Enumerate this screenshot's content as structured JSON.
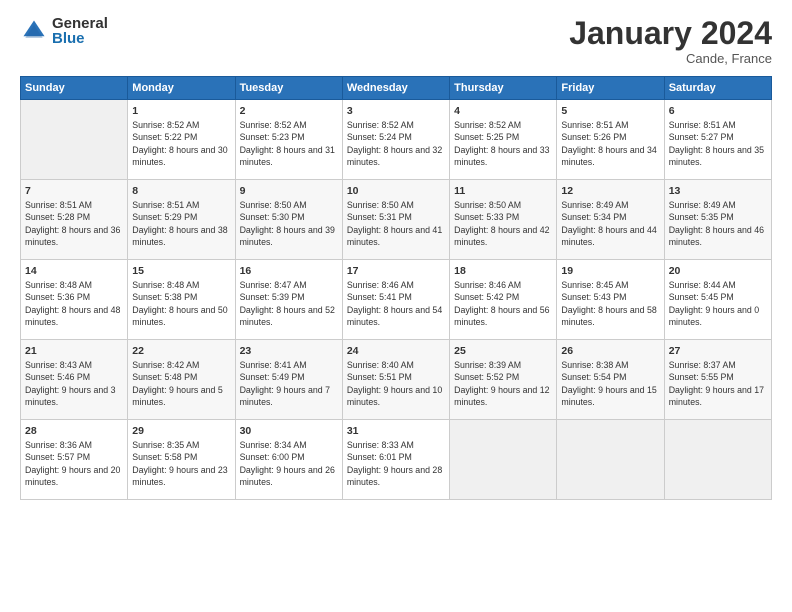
{
  "header": {
    "logo_general": "General",
    "logo_blue": "Blue",
    "title": "January 2024",
    "subtitle": "Cande, France"
  },
  "weekdays": [
    "Sunday",
    "Monday",
    "Tuesday",
    "Wednesday",
    "Thursday",
    "Friday",
    "Saturday"
  ],
  "weeks": [
    [
      {
        "day": "",
        "sunrise": "",
        "sunset": "",
        "daylight": ""
      },
      {
        "day": "1",
        "sunrise": "Sunrise: 8:52 AM",
        "sunset": "Sunset: 5:22 PM",
        "daylight": "Daylight: 8 hours and 30 minutes."
      },
      {
        "day": "2",
        "sunrise": "Sunrise: 8:52 AM",
        "sunset": "Sunset: 5:23 PM",
        "daylight": "Daylight: 8 hours and 31 minutes."
      },
      {
        "day": "3",
        "sunrise": "Sunrise: 8:52 AM",
        "sunset": "Sunset: 5:24 PM",
        "daylight": "Daylight: 8 hours and 32 minutes."
      },
      {
        "day": "4",
        "sunrise": "Sunrise: 8:52 AM",
        "sunset": "Sunset: 5:25 PM",
        "daylight": "Daylight: 8 hours and 33 minutes."
      },
      {
        "day": "5",
        "sunrise": "Sunrise: 8:51 AM",
        "sunset": "Sunset: 5:26 PM",
        "daylight": "Daylight: 8 hours and 34 minutes."
      },
      {
        "day": "6",
        "sunrise": "Sunrise: 8:51 AM",
        "sunset": "Sunset: 5:27 PM",
        "daylight": "Daylight: 8 hours and 35 minutes."
      }
    ],
    [
      {
        "day": "7",
        "sunrise": "Sunrise: 8:51 AM",
        "sunset": "Sunset: 5:28 PM",
        "daylight": "Daylight: 8 hours and 36 minutes."
      },
      {
        "day": "8",
        "sunrise": "Sunrise: 8:51 AM",
        "sunset": "Sunset: 5:29 PM",
        "daylight": "Daylight: 8 hours and 38 minutes."
      },
      {
        "day": "9",
        "sunrise": "Sunrise: 8:50 AM",
        "sunset": "Sunset: 5:30 PM",
        "daylight": "Daylight: 8 hours and 39 minutes."
      },
      {
        "day": "10",
        "sunrise": "Sunrise: 8:50 AM",
        "sunset": "Sunset: 5:31 PM",
        "daylight": "Daylight: 8 hours and 41 minutes."
      },
      {
        "day": "11",
        "sunrise": "Sunrise: 8:50 AM",
        "sunset": "Sunset: 5:33 PM",
        "daylight": "Daylight: 8 hours and 42 minutes."
      },
      {
        "day": "12",
        "sunrise": "Sunrise: 8:49 AM",
        "sunset": "Sunset: 5:34 PM",
        "daylight": "Daylight: 8 hours and 44 minutes."
      },
      {
        "day": "13",
        "sunrise": "Sunrise: 8:49 AM",
        "sunset": "Sunset: 5:35 PM",
        "daylight": "Daylight: 8 hours and 46 minutes."
      }
    ],
    [
      {
        "day": "14",
        "sunrise": "Sunrise: 8:48 AM",
        "sunset": "Sunset: 5:36 PM",
        "daylight": "Daylight: 8 hours and 48 minutes."
      },
      {
        "day": "15",
        "sunrise": "Sunrise: 8:48 AM",
        "sunset": "Sunset: 5:38 PM",
        "daylight": "Daylight: 8 hours and 50 minutes."
      },
      {
        "day": "16",
        "sunrise": "Sunrise: 8:47 AM",
        "sunset": "Sunset: 5:39 PM",
        "daylight": "Daylight: 8 hours and 52 minutes."
      },
      {
        "day": "17",
        "sunrise": "Sunrise: 8:46 AM",
        "sunset": "Sunset: 5:41 PM",
        "daylight": "Daylight: 8 hours and 54 minutes."
      },
      {
        "day": "18",
        "sunrise": "Sunrise: 8:46 AM",
        "sunset": "Sunset: 5:42 PM",
        "daylight": "Daylight: 8 hours and 56 minutes."
      },
      {
        "day": "19",
        "sunrise": "Sunrise: 8:45 AM",
        "sunset": "Sunset: 5:43 PM",
        "daylight": "Daylight: 8 hours and 58 minutes."
      },
      {
        "day": "20",
        "sunrise": "Sunrise: 8:44 AM",
        "sunset": "Sunset: 5:45 PM",
        "daylight": "Daylight: 9 hours and 0 minutes."
      }
    ],
    [
      {
        "day": "21",
        "sunrise": "Sunrise: 8:43 AM",
        "sunset": "Sunset: 5:46 PM",
        "daylight": "Daylight: 9 hours and 3 minutes."
      },
      {
        "day": "22",
        "sunrise": "Sunrise: 8:42 AM",
        "sunset": "Sunset: 5:48 PM",
        "daylight": "Daylight: 9 hours and 5 minutes."
      },
      {
        "day": "23",
        "sunrise": "Sunrise: 8:41 AM",
        "sunset": "Sunset: 5:49 PM",
        "daylight": "Daylight: 9 hours and 7 minutes."
      },
      {
        "day": "24",
        "sunrise": "Sunrise: 8:40 AM",
        "sunset": "Sunset: 5:51 PM",
        "daylight": "Daylight: 9 hours and 10 minutes."
      },
      {
        "day": "25",
        "sunrise": "Sunrise: 8:39 AM",
        "sunset": "Sunset: 5:52 PM",
        "daylight": "Daylight: 9 hours and 12 minutes."
      },
      {
        "day": "26",
        "sunrise": "Sunrise: 8:38 AM",
        "sunset": "Sunset: 5:54 PM",
        "daylight": "Daylight: 9 hours and 15 minutes."
      },
      {
        "day": "27",
        "sunrise": "Sunrise: 8:37 AM",
        "sunset": "Sunset: 5:55 PM",
        "daylight": "Daylight: 9 hours and 17 minutes."
      }
    ],
    [
      {
        "day": "28",
        "sunrise": "Sunrise: 8:36 AM",
        "sunset": "Sunset: 5:57 PM",
        "daylight": "Daylight: 9 hours and 20 minutes."
      },
      {
        "day": "29",
        "sunrise": "Sunrise: 8:35 AM",
        "sunset": "Sunset: 5:58 PM",
        "daylight": "Daylight: 9 hours and 23 minutes."
      },
      {
        "day": "30",
        "sunrise": "Sunrise: 8:34 AM",
        "sunset": "Sunset: 6:00 PM",
        "daylight": "Daylight: 9 hours and 26 minutes."
      },
      {
        "day": "31",
        "sunrise": "Sunrise: 8:33 AM",
        "sunset": "Sunset: 6:01 PM",
        "daylight": "Daylight: 9 hours and 28 minutes."
      },
      {
        "day": "",
        "sunrise": "",
        "sunset": "",
        "daylight": ""
      },
      {
        "day": "",
        "sunrise": "",
        "sunset": "",
        "daylight": ""
      },
      {
        "day": "",
        "sunrise": "",
        "sunset": "",
        "daylight": ""
      }
    ]
  ]
}
